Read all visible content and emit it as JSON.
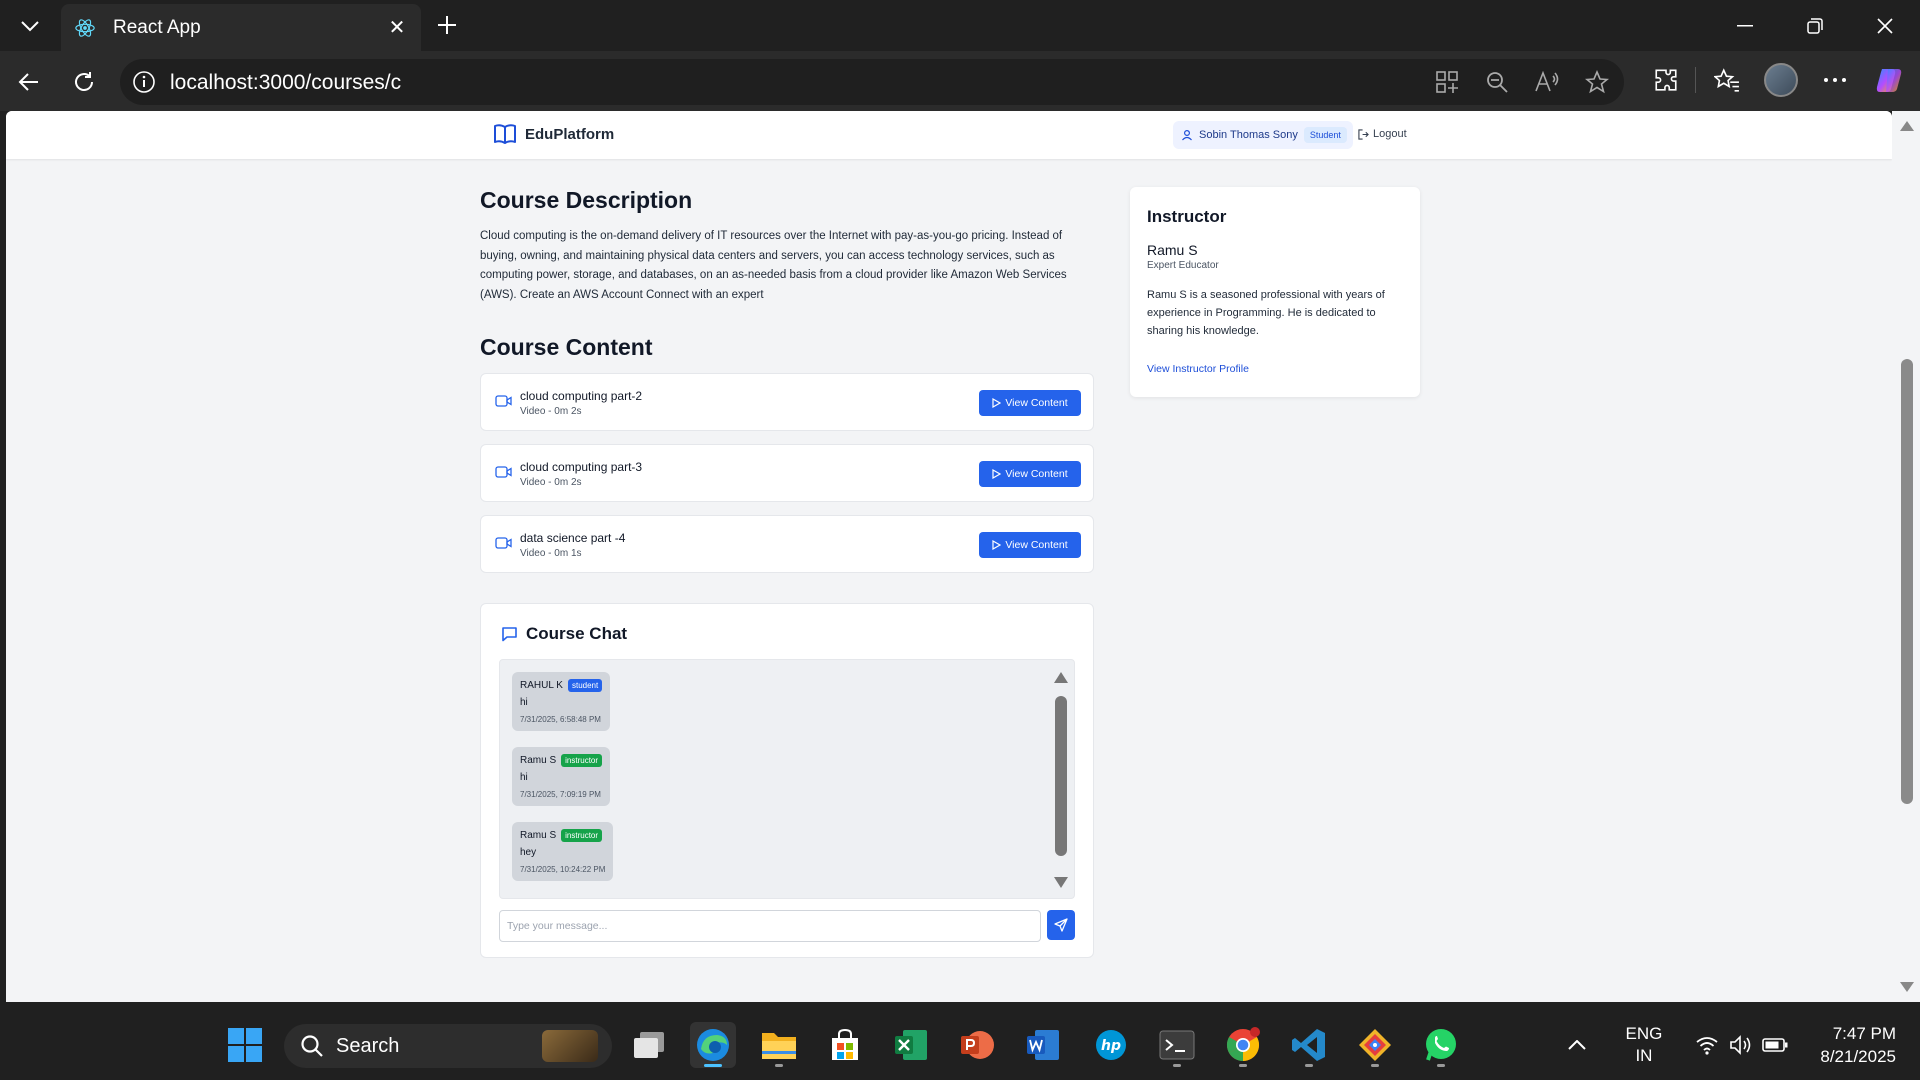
{
  "browser": {
    "tab_title": "React App",
    "url": "localhost:3000/courses/c"
  },
  "header": {
    "brand": "EduPlatform",
    "user_name": "Sobin Thomas Sony",
    "user_role": "Student",
    "logout": "Logout"
  },
  "description": {
    "title": "Course Description",
    "text": "Cloud computing is the on-demand delivery of IT resources over the Internet with pay-as-you-go pricing. Instead of buying, owning, and maintaining physical data centers and servers, you can access technology services, such as computing power, storage, and databases, on an as-needed basis from a cloud provider like Amazon Web Services (AWS). Create an AWS Account Connect with an expert"
  },
  "content": {
    "title": "Course Content",
    "items": [
      {
        "title": "cloud computing part-2",
        "meta": "Video - 0m 2s",
        "button": "View Content"
      },
      {
        "title": "cloud computing part-3",
        "meta": "Video - 0m 2s",
        "button": "View Content"
      },
      {
        "title": "data science part -4",
        "meta": "Video - 0m 1s",
        "button": "View Content"
      }
    ]
  },
  "chat": {
    "title": "Course Chat",
    "messages": [
      {
        "author": "RAHUL K",
        "role": "student",
        "text": "hi",
        "time": "7/31/2025, 6:58:48 PM"
      },
      {
        "author": "Ramu S",
        "role": "instructor",
        "text": "hi",
        "time": "7/31/2025, 7:09:19 PM"
      },
      {
        "author": "Ramu S",
        "role": "instructor",
        "text": "hey",
        "time": "7/31/2025, 10:24:22 PM"
      }
    ],
    "input_placeholder": "Type your message...",
    "role_colors": {
      "student": "#2563eb",
      "instructor": "#16a34a"
    }
  },
  "instructor": {
    "heading": "Instructor",
    "name": "Ramu S",
    "title": "Expert Educator",
    "bio": "Ramu S is a seasoned professional with years of experience in Programming. He is dedicated to sharing his knowledge.",
    "link": "View Instructor Profile"
  },
  "taskbar": {
    "search_label": "Search",
    "lang_line1": "ENG",
    "lang_line2": "IN",
    "time": "7:47 PM",
    "date": "8/21/2025"
  }
}
